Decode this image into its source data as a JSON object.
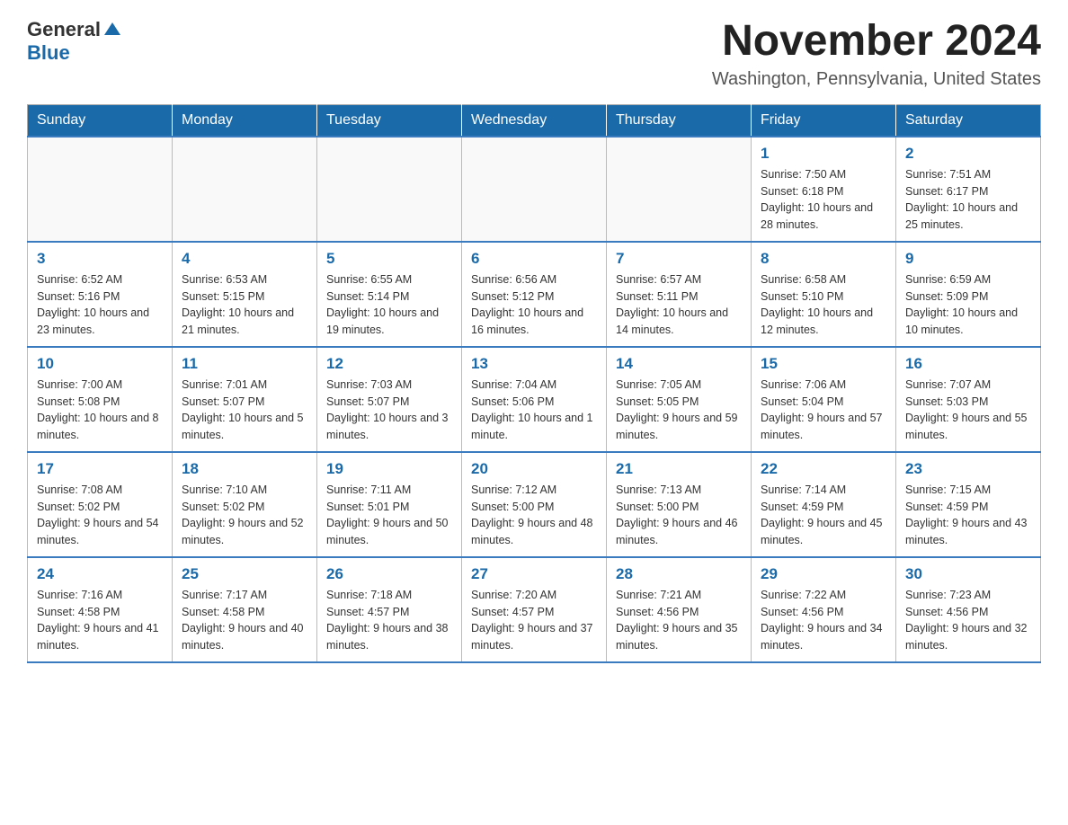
{
  "header": {
    "logo_general": "General",
    "logo_blue": "Blue",
    "month_title": "November 2024",
    "location": "Washington, Pennsylvania, United States"
  },
  "weekdays": [
    "Sunday",
    "Monday",
    "Tuesday",
    "Wednesday",
    "Thursday",
    "Friday",
    "Saturday"
  ],
  "weeks": [
    [
      {
        "day": "",
        "sunrise": "",
        "sunset": "",
        "daylight": ""
      },
      {
        "day": "",
        "sunrise": "",
        "sunset": "",
        "daylight": ""
      },
      {
        "day": "",
        "sunrise": "",
        "sunset": "",
        "daylight": ""
      },
      {
        "day": "",
        "sunrise": "",
        "sunset": "",
        "daylight": ""
      },
      {
        "day": "",
        "sunrise": "",
        "sunset": "",
        "daylight": ""
      },
      {
        "day": "1",
        "sunrise": "Sunrise: 7:50 AM",
        "sunset": "Sunset: 6:18 PM",
        "daylight": "Daylight: 10 hours and 28 minutes."
      },
      {
        "day": "2",
        "sunrise": "Sunrise: 7:51 AM",
        "sunset": "Sunset: 6:17 PM",
        "daylight": "Daylight: 10 hours and 25 minutes."
      }
    ],
    [
      {
        "day": "3",
        "sunrise": "Sunrise: 6:52 AM",
        "sunset": "Sunset: 5:16 PM",
        "daylight": "Daylight: 10 hours and 23 minutes."
      },
      {
        "day": "4",
        "sunrise": "Sunrise: 6:53 AM",
        "sunset": "Sunset: 5:15 PM",
        "daylight": "Daylight: 10 hours and 21 minutes."
      },
      {
        "day": "5",
        "sunrise": "Sunrise: 6:55 AM",
        "sunset": "Sunset: 5:14 PM",
        "daylight": "Daylight: 10 hours and 19 minutes."
      },
      {
        "day": "6",
        "sunrise": "Sunrise: 6:56 AM",
        "sunset": "Sunset: 5:12 PM",
        "daylight": "Daylight: 10 hours and 16 minutes."
      },
      {
        "day": "7",
        "sunrise": "Sunrise: 6:57 AM",
        "sunset": "Sunset: 5:11 PM",
        "daylight": "Daylight: 10 hours and 14 minutes."
      },
      {
        "day": "8",
        "sunrise": "Sunrise: 6:58 AM",
        "sunset": "Sunset: 5:10 PM",
        "daylight": "Daylight: 10 hours and 12 minutes."
      },
      {
        "day": "9",
        "sunrise": "Sunrise: 6:59 AM",
        "sunset": "Sunset: 5:09 PM",
        "daylight": "Daylight: 10 hours and 10 minutes."
      }
    ],
    [
      {
        "day": "10",
        "sunrise": "Sunrise: 7:00 AM",
        "sunset": "Sunset: 5:08 PM",
        "daylight": "Daylight: 10 hours and 8 minutes."
      },
      {
        "day": "11",
        "sunrise": "Sunrise: 7:01 AM",
        "sunset": "Sunset: 5:07 PM",
        "daylight": "Daylight: 10 hours and 5 minutes."
      },
      {
        "day": "12",
        "sunrise": "Sunrise: 7:03 AM",
        "sunset": "Sunset: 5:07 PM",
        "daylight": "Daylight: 10 hours and 3 minutes."
      },
      {
        "day": "13",
        "sunrise": "Sunrise: 7:04 AM",
        "sunset": "Sunset: 5:06 PM",
        "daylight": "Daylight: 10 hours and 1 minute."
      },
      {
        "day": "14",
        "sunrise": "Sunrise: 7:05 AM",
        "sunset": "Sunset: 5:05 PM",
        "daylight": "Daylight: 9 hours and 59 minutes."
      },
      {
        "day": "15",
        "sunrise": "Sunrise: 7:06 AM",
        "sunset": "Sunset: 5:04 PM",
        "daylight": "Daylight: 9 hours and 57 minutes."
      },
      {
        "day": "16",
        "sunrise": "Sunrise: 7:07 AM",
        "sunset": "Sunset: 5:03 PM",
        "daylight": "Daylight: 9 hours and 55 minutes."
      }
    ],
    [
      {
        "day": "17",
        "sunrise": "Sunrise: 7:08 AM",
        "sunset": "Sunset: 5:02 PM",
        "daylight": "Daylight: 9 hours and 54 minutes."
      },
      {
        "day": "18",
        "sunrise": "Sunrise: 7:10 AM",
        "sunset": "Sunset: 5:02 PM",
        "daylight": "Daylight: 9 hours and 52 minutes."
      },
      {
        "day": "19",
        "sunrise": "Sunrise: 7:11 AM",
        "sunset": "Sunset: 5:01 PM",
        "daylight": "Daylight: 9 hours and 50 minutes."
      },
      {
        "day": "20",
        "sunrise": "Sunrise: 7:12 AM",
        "sunset": "Sunset: 5:00 PM",
        "daylight": "Daylight: 9 hours and 48 minutes."
      },
      {
        "day": "21",
        "sunrise": "Sunrise: 7:13 AM",
        "sunset": "Sunset: 5:00 PM",
        "daylight": "Daylight: 9 hours and 46 minutes."
      },
      {
        "day": "22",
        "sunrise": "Sunrise: 7:14 AM",
        "sunset": "Sunset: 4:59 PM",
        "daylight": "Daylight: 9 hours and 45 minutes."
      },
      {
        "day": "23",
        "sunrise": "Sunrise: 7:15 AM",
        "sunset": "Sunset: 4:59 PM",
        "daylight": "Daylight: 9 hours and 43 minutes."
      }
    ],
    [
      {
        "day": "24",
        "sunrise": "Sunrise: 7:16 AM",
        "sunset": "Sunset: 4:58 PM",
        "daylight": "Daylight: 9 hours and 41 minutes."
      },
      {
        "day": "25",
        "sunrise": "Sunrise: 7:17 AM",
        "sunset": "Sunset: 4:58 PM",
        "daylight": "Daylight: 9 hours and 40 minutes."
      },
      {
        "day": "26",
        "sunrise": "Sunrise: 7:18 AM",
        "sunset": "Sunset: 4:57 PM",
        "daylight": "Daylight: 9 hours and 38 minutes."
      },
      {
        "day": "27",
        "sunrise": "Sunrise: 7:20 AM",
        "sunset": "Sunset: 4:57 PM",
        "daylight": "Daylight: 9 hours and 37 minutes."
      },
      {
        "day": "28",
        "sunrise": "Sunrise: 7:21 AM",
        "sunset": "Sunset: 4:56 PM",
        "daylight": "Daylight: 9 hours and 35 minutes."
      },
      {
        "day": "29",
        "sunrise": "Sunrise: 7:22 AM",
        "sunset": "Sunset: 4:56 PM",
        "daylight": "Daylight: 9 hours and 34 minutes."
      },
      {
        "day": "30",
        "sunrise": "Sunrise: 7:23 AM",
        "sunset": "Sunset: 4:56 PM",
        "daylight": "Daylight: 9 hours and 32 minutes."
      }
    ]
  ]
}
